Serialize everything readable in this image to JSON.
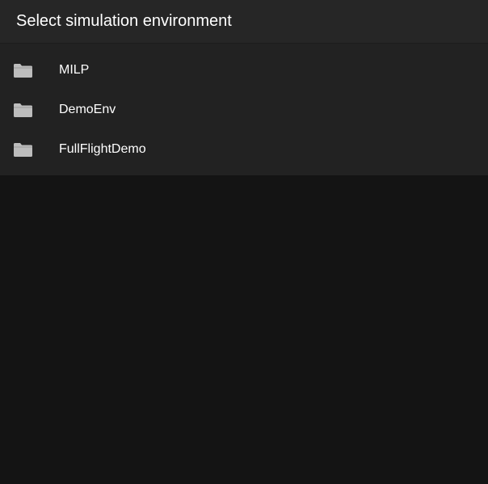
{
  "dialog": {
    "title": "Select simulation environment",
    "items": [
      {
        "label": "MILP",
        "icon": "folder-icon"
      },
      {
        "label": "DemoEnv",
        "icon": "folder-icon"
      },
      {
        "label": "FullFlightDemo",
        "icon": "folder-icon"
      }
    ]
  },
  "colors": {
    "background": "#141414",
    "panel": "#222222",
    "header": "#262626",
    "text": "#ffffff",
    "folder_icon": "#bdbdbd"
  }
}
